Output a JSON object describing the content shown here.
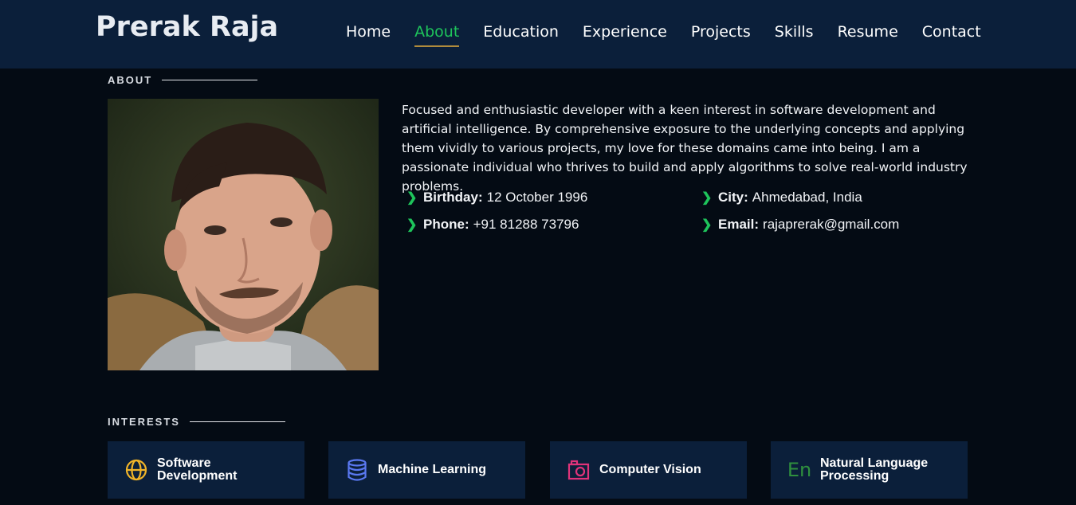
{
  "header": {
    "brand": "Prerak Raja",
    "nav": [
      "Home",
      "About",
      "Education",
      "Experience",
      "Projects",
      "Skills",
      "Resume",
      "Contact"
    ],
    "active": "About"
  },
  "about": {
    "title": "ABOUT",
    "bio": "Focused and enthusiastic developer with a keen interest in software development and artificial intelligence. By comprehensive exposure to the underlying concepts and applying them vividly to various projects, my love for these domains came into being. I am a passionate individual who thrives to build and apply algorithms to solve real-world industry problems.",
    "facts": {
      "birthday_label": "Birthday:",
      "birthday": "12 October 1996",
      "city_label": "City:",
      "city": "Ahmedabad, India",
      "phone_label": "Phone:",
      "phone": "+91 81288 73796",
      "email_label": "Email:",
      "email": "rajaprerak@gmail.com"
    }
  },
  "interests": {
    "title": "INTERESTS",
    "items": [
      {
        "label": "Software Development",
        "icon": "globe-icon",
        "color": "#f0b429"
      },
      {
        "label": "Machine Learning",
        "icon": "database-icon",
        "color": "#5a78f0"
      },
      {
        "label": "Computer Vision",
        "icon": "camera-icon",
        "color": "#e0337a"
      },
      {
        "label": "Natural Language Processing",
        "icon": "language-icon",
        "color": "#2f8f3e"
      }
    ]
  },
  "colors": {
    "accent": "#1ec45b",
    "header_bg": "#0b1f3a",
    "page_bg": "#040b14"
  }
}
